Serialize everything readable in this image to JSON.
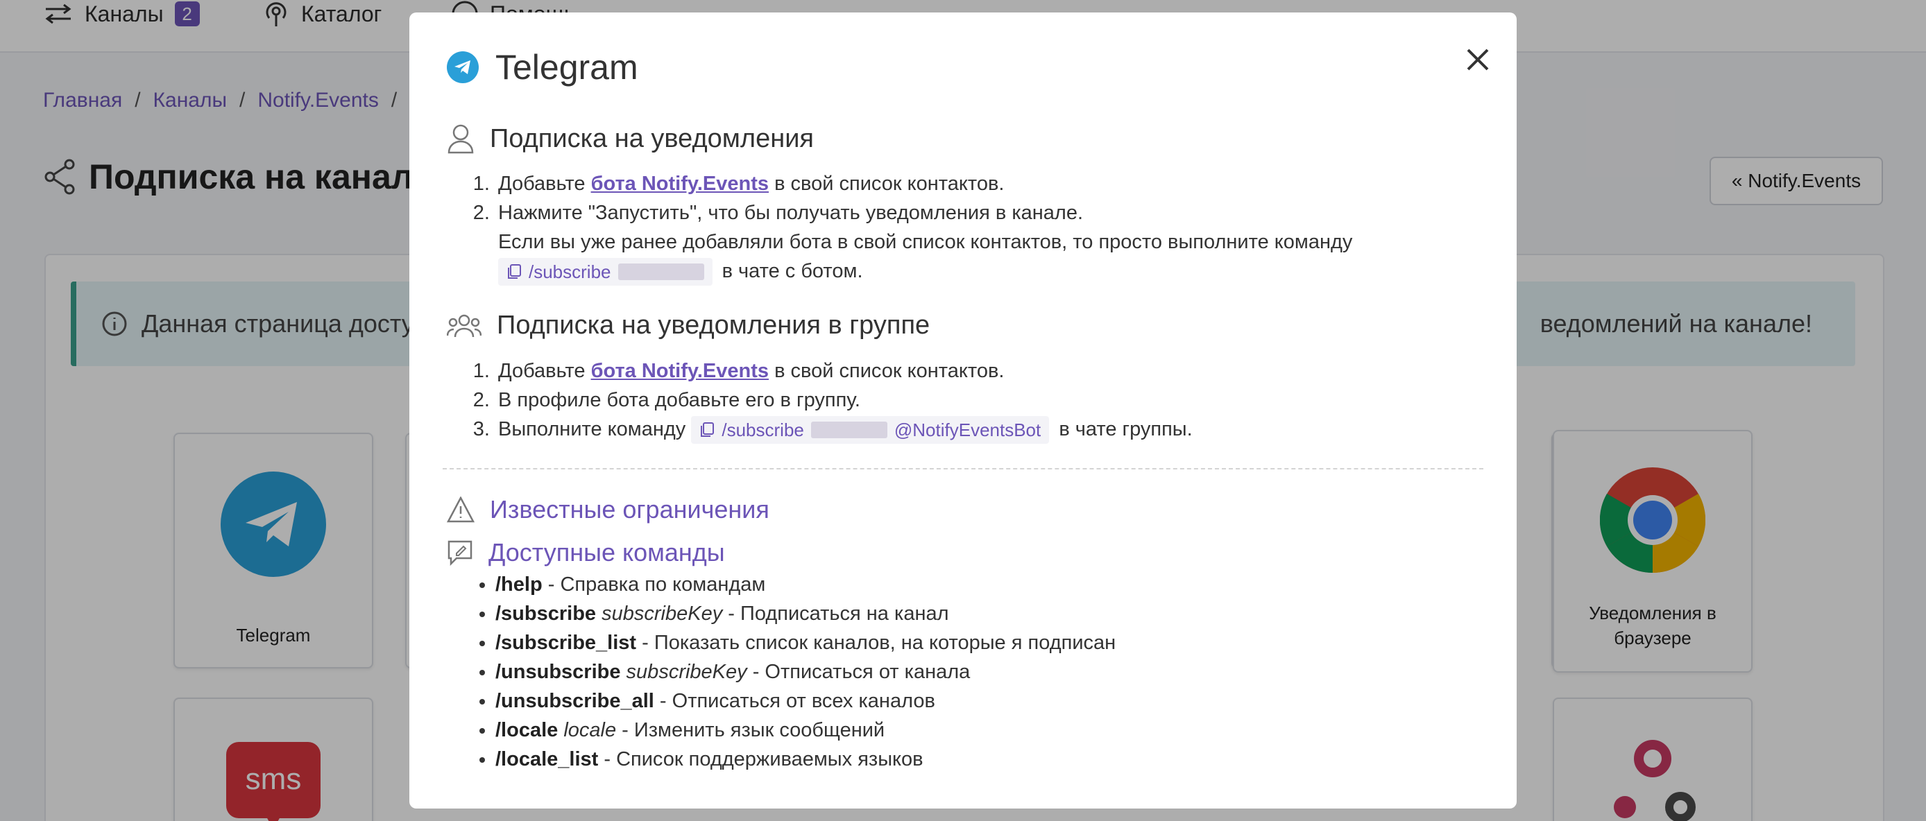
{
  "nav": {
    "channels_label": "Каналы",
    "channels_count": "2",
    "catalog_label": "Каталог",
    "help_label": "Помощь"
  },
  "breadcrumb": [
    {
      "label": "Главная"
    },
    {
      "label": "Каналы"
    },
    {
      "label": "Notify.Events"
    }
  ],
  "breadcrumb_sep": "/",
  "page": {
    "title": "Подписка на канал",
    "back_button": "« Notify.Events",
    "alert_left": "Данная страница досту",
    "alert_right": "ведомлений на канале!"
  },
  "cards": [
    {
      "label": "Telegram"
    },
    {
      "label": "Уведомления в браузере"
    }
  ],
  "modal": {
    "title": "Telegram",
    "section_personal": {
      "heading": "Подписка на уведомления",
      "step1_before": "Добавьте ",
      "step1_link": "бота Notify.Events",
      "step1_after": " в свой список контактов.",
      "step2": "Нажмите \"Запустить\", что бы получать уведомления в канале.",
      "step2_note": "Если вы уже ранее добавляли бота в свой список контактов, то просто выполните команду",
      "command": "/subscribe",
      "command_after": "в чате с ботом."
    },
    "section_group": {
      "heading": "Подписка на уведомления в группе",
      "step1_before": "Добавьте ",
      "step1_link": "бота Notify.Events",
      "step1_after": " в свой список контактов.",
      "step2": "В профиле бота добавьте его в группу.",
      "step3_before": "Выполните команду",
      "command": "/subscribe",
      "command_suffix": "@NotifyEventsBot",
      "step3_after": "в чате группы."
    },
    "limitations_heading": "Известные ограничения",
    "commands_heading": "Доступные команды",
    "commands": [
      {
        "cmd": "/help",
        "arg": "",
        "desc": " - Справка по командам"
      },
      {
        "cmd": "/subscribe",
        "arg": " subscribeKey",
        "desc": " - Подписаться на канал"
      },
      {
        "cmd": "/subscribe_list",
        "arg": "",
        "desc": " - Показать список каналов, на которые я подписан"
      },
      {
        "cmd": "/unsubscribe",
        "arg": " subscribeKey",
        "desc": " - Отписаться от канала"
      },
      {
        "cmd": "/unsubscribe_all",
        "arg": "",
        "desc": " - Отписаться от всех каналов"
      },
      {
        "cmd": "/locale",
        "arg": " locale",
        "desc": " - Изменить язык сообщений"
      },
      {
        "cmd": "/locale_list",
        "arg": "",
        "desc": " - Список поддерживаемых языков"
      }
    ]
  },
  "colors": {
    "accent": "#6c55b7",
    "telegram_blue": "#2a9fd8",
    "alert_border": "#3aa08d",
    "sms_red": "#d9363e"
  }
}
